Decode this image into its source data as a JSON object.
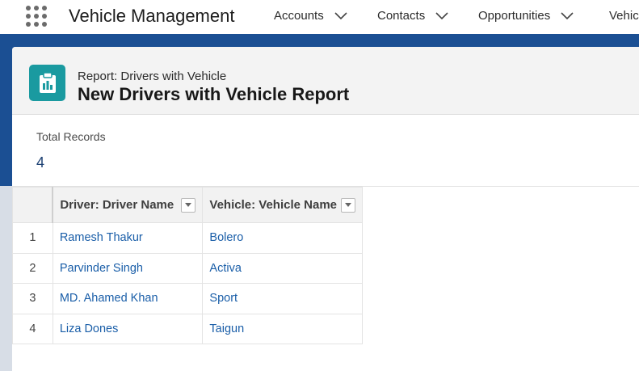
{
  "app": {
    "name": "Vehicle Management"
  },
  "nav": {
    "items": [
      {
        "label": "Accounts"
      },
      {
        "label": "Contacts"
      },
      {
        "label": "Opportunities"
      },
      {
        "label": "Vehic"
      }
    ]
  },
  "header": {
    "eyebrow": "Report: Drivers with Vehicle",
    "title": "New Drivers with Vehicle Report",
    "icon": "report-icon"
  },
  "summary": {
    "total_label": "Total Records",
    "total_value": "4"
  },
  "table": {
    "columns": [
      "Driver: Driver Name",
      "Vehicle: Vehicle Name"
    ],
    "rows": [
      {
        "num": "1",
        "driver": "Ramesh Thakur",
        "vehicle": "Bolero"
      },
      {
        "num": "2",
        "driver": "Parvinder Singh",
        "vehicle": "Activa"
      },
      {
        "num": "3",
        "driver": "MD. Ahamed Khan",
        "vehicle": "Sport"
      },
      {
        "num": "4",
        "driver": "Liza Dones",
        "vehicle": "Taigun"
      }
    ]
  },
  "colors": {
    "brand_band": "#1b4f93",
    "icon_teal": "#1a9aa0",
    "link": "#1a5ea8"
  }
}
